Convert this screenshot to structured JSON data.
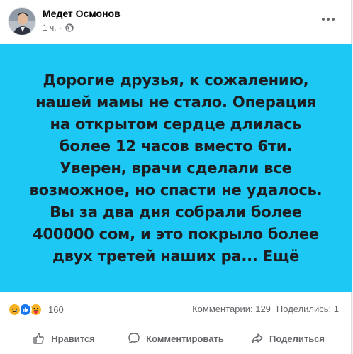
{
  "post": {
    "author_name": "Медет Осмонов",
    "time": "1 ч.",
    "separator": "·",
    "privacy_icon": "globe-icon",
    "menu_icon": "more-horizontal-icon",
    "card": {
      "background_color": "#1ec8f4",
      "text": "Дорогие друзья, к сожалению, нашей мамы не стало. Операция на открытом сердце длилась более 12 часов вместо 6ти. Уверен, врачи сделали все возможное, но спасти не удалось. Вы за два дня собрали более 400000 сом, и это покрыло более двух третей наших ра...",
      "see_more": " Ещё"
    },
    "stats": {
      "reaction_icons": [
        "sad-reaction-icon",
        "like-reaction-icon",
        "care-reaction-icon"
      ],
      "reaction_count": "160",
      "comments": "Комментарии: 129",
      "shares": "Поделились: 1"
    },
    "actions": {
      "like_label": "Нравится",
      "comment_label": "Комментировать",
      "share_label": "Поделиться"
    }
  }
}
